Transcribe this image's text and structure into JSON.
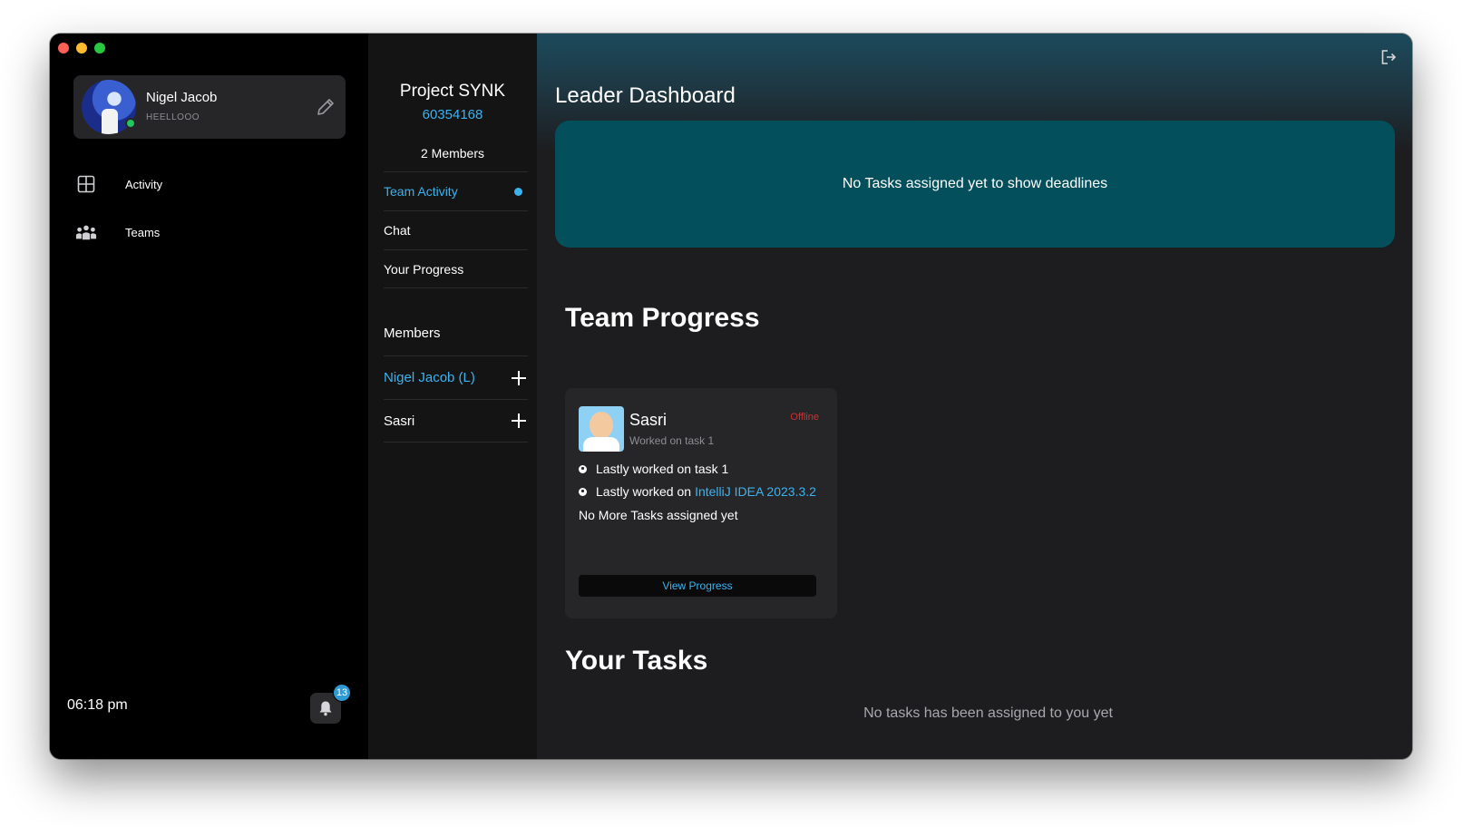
{
  "user": {
    "name": "Nigel Jacob",
    "status_text": "HEELLOOO"
  },
  "sidebar": {
    "items": [
      {
        "label": "Activity",
        "icon": "grid-icon"
      },
      {
        "label": "Teams",
        "icon": "team-icon"
      }
    ],
    "clock": "06:18 pm",
    "notification_count": "13"
  },
  "project": {
    "name": "Project SYNK",
    "code": "60354168",
    "members_count_label": "2 Members",
    "menu": [
      {
        "label": "Team Activity",
        "active": true
      },
      {
        "label": "Chat"
      },
      {
        "label": "Your Progress"
      }
    ],
    "members_title": "Members",
    "members": [
      {
        "name": "Nigel Jacob (L)",
        "leader": true
      },
      {
        "name": "Sasri"
      }
    ]
  },
  "dashboard": {
    "title": "Leader Dashboard",
    "deadline_message": "No Tasks assigned yet to show deadlines",
    "team_progress_title": "Team Progress",
    "member_card": {
      "name": "Sasri",
      "subtitle": "Worked on task 1",
      "status": "Offline",
      "line1": "Lastly worked on task 1",
      "line2_prefix": "Lastly worked on",
      "line2_app": "IntelliJ IDEA 2023.3.2",
      "line3": "No More Tasks assigned yet",
      "button_label": "View Progress"
    },
    "your_tasks_title": "Your Tasks",
    "no_tasks_message": "No tasks has been assigned to you yet"
  },
  "colors": {
    "accent": "#3bb3f0",
    "deadline_card": "#03505c",
    "online": "#22c55e",
    "offline": "#d32f2f"
  }
}
